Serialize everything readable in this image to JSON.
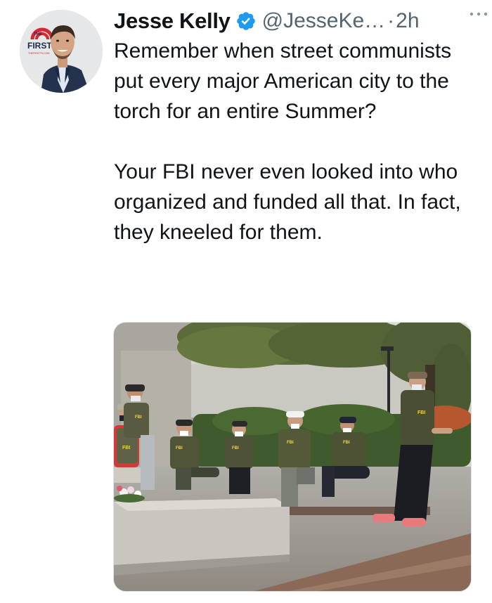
{
  "tweet": {
    "author": {
      "name": "Jesse Kelly",
      "handle": "@JesseKe…",
      "verified": true
    },
    "separator": "·",
    "time": "2h",
    "text": {
      "paragraph1": "Remember when street communists put every major American city to the torch for an entire Summer?",
      "paragraph2": "Your FBI never even looked into who organized and funded all that. In fact, they kneeled for them."
    },
    "avatar_logo": {
      "line1": "THE",
      "line2": "FIRST",
      "line3": "THEFIRSTTV.COM"
    },
    "photo": {
      "vest_label": "FBI"
    }
  },
  "icons": {
    "verified": "verified-badge-icon",
    "more": "more-horizontal-icon"
  },
  "colors": {
    "text": "#0f1419",
    "secondary": "#536471",
    "verified": "#1d9bf0",
    "logo_red": "#d6272e"
  }
}
